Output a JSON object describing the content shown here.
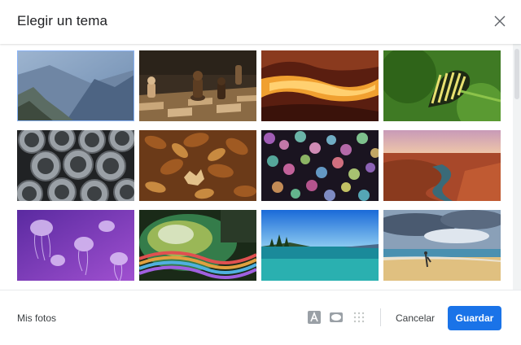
{
  "dialog": {
    "title": "Elegir un tema",
    "close_icon": "close-icon"
  },
  "themes": [
    {
      "name": "mountains",
      "selected": true
    },
    {
      "name": "chess"
    },
    {
      "name": "canyon"
    },
    {
      "name": "caterpillar"
    },
    {
      "name": "pipes"
    },
    {
      "name": "leaves"
    },
    {
      "name": "bokeh"
    },
    {
      "name": "river-canyon"
    },
    {
      "name": "jellyfish"
    },
    {
      "name": "rainbow"
    },
    {
      "name": "lake"
    },
    {
      "name": "beach"
    }
  ],
  "footer": {
    "my_photos": "Mis fotos",
    "text_color_icon": "text-color-icon",
    "vignette_icon": "vignette-icon",
    "blur_icon": "blur-icon",
    "cancel": "Cancelar",
    "save": "Guardar"
  },
  "colors": {
    "primary": "#1a73e8",
    "selected_outline": "#8ab4f8"
  }
}
